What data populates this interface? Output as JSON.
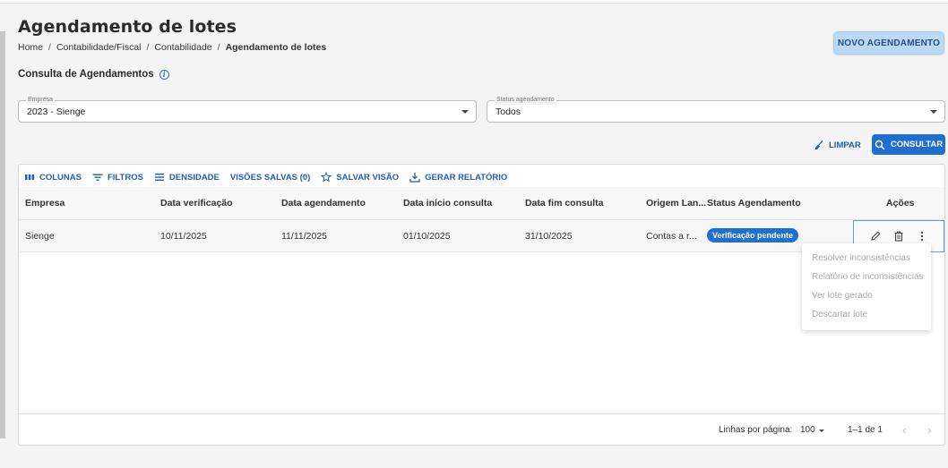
{
  "page": {
    "title": "Agendamento de lotes",
    "breadcrumb": [
      "Home",
      "Contabilidade/Fiscal",
      "Contabilidade",
      "Agendamento de lotes"
    ],
    "new_button": "NOVO AGENDAMENTO"
  },
  "section": {
    "title": "Consulta de Agendamentos"
  },
  "filters": {
    "empresa": {
      "label": "Empresa",
      "value": "2023 - Sienge"
    },
    "status": {
      "label": "Status agendamento",
      "value": "Todos"
    },
    "clear_label": "LIMPAR",
    "search_label": "CONSULTAR"
  },
  "toolbar": {
    "columns": "COLUNAS",
    "filters": "FILTROS",
    "density": "DENSIDADE",
    "saved_views": "VISÕES SALVAS (0)",
    "save_view": "SALVAR VISÃO",
    "report": "GERAR RELATÓRIO"
  },
  "table": {
    "headers": [
      "Empresa",
      "Data verificação",
      "Data agendamento",
      "Data início consulta",
      "Data fim consulta",
      "Origem Lan...",
      "Status Agendamento",
      "Ações"
    ],
    "rows": [
      {
        "empresa": "Sienge",
        "data_verificacao": "10/11/2025",
        "data_agendamento": "11/11/2025",
        "data_inicio": "01/10/2025",
        "data_fim": "31/10/2025",
        "origem": "Contas a r...",
        "status": "Verificação pendente"
      }
    ]
  },
  "menu": {
    "items": [
      "Resolver inconsistências",
      "Relatório de inconsistências",
      "Ver lote gerado",
      "Descartar lote"
    ]
  },
  "pagination": {
    "rows_per_page_label": "Linhas por página:",
    "rows_per_page": "100",
    "range": "1–1 de 1"
  },
  "colors": {
    "primary": "#1f6fd0",
    "link": "#1d5fb0",
    "badge": "#1f6fd0",
    "new_button_bg": "#bcd8f3"
  },
  "icons": [
    "info-icon",
    "broom-icon",
    "search-icon",
    "columns-icon",
    "filter-icon",
    "density-icon",
    "star-icon",
    "download-icon",
    "edit-icon",
    "trash-icon",
    "more-vert-icon",
    "chevron-left-icon",
    "chevron-right-icon",
    "dropdown-arrow-icon"
  ]
}
